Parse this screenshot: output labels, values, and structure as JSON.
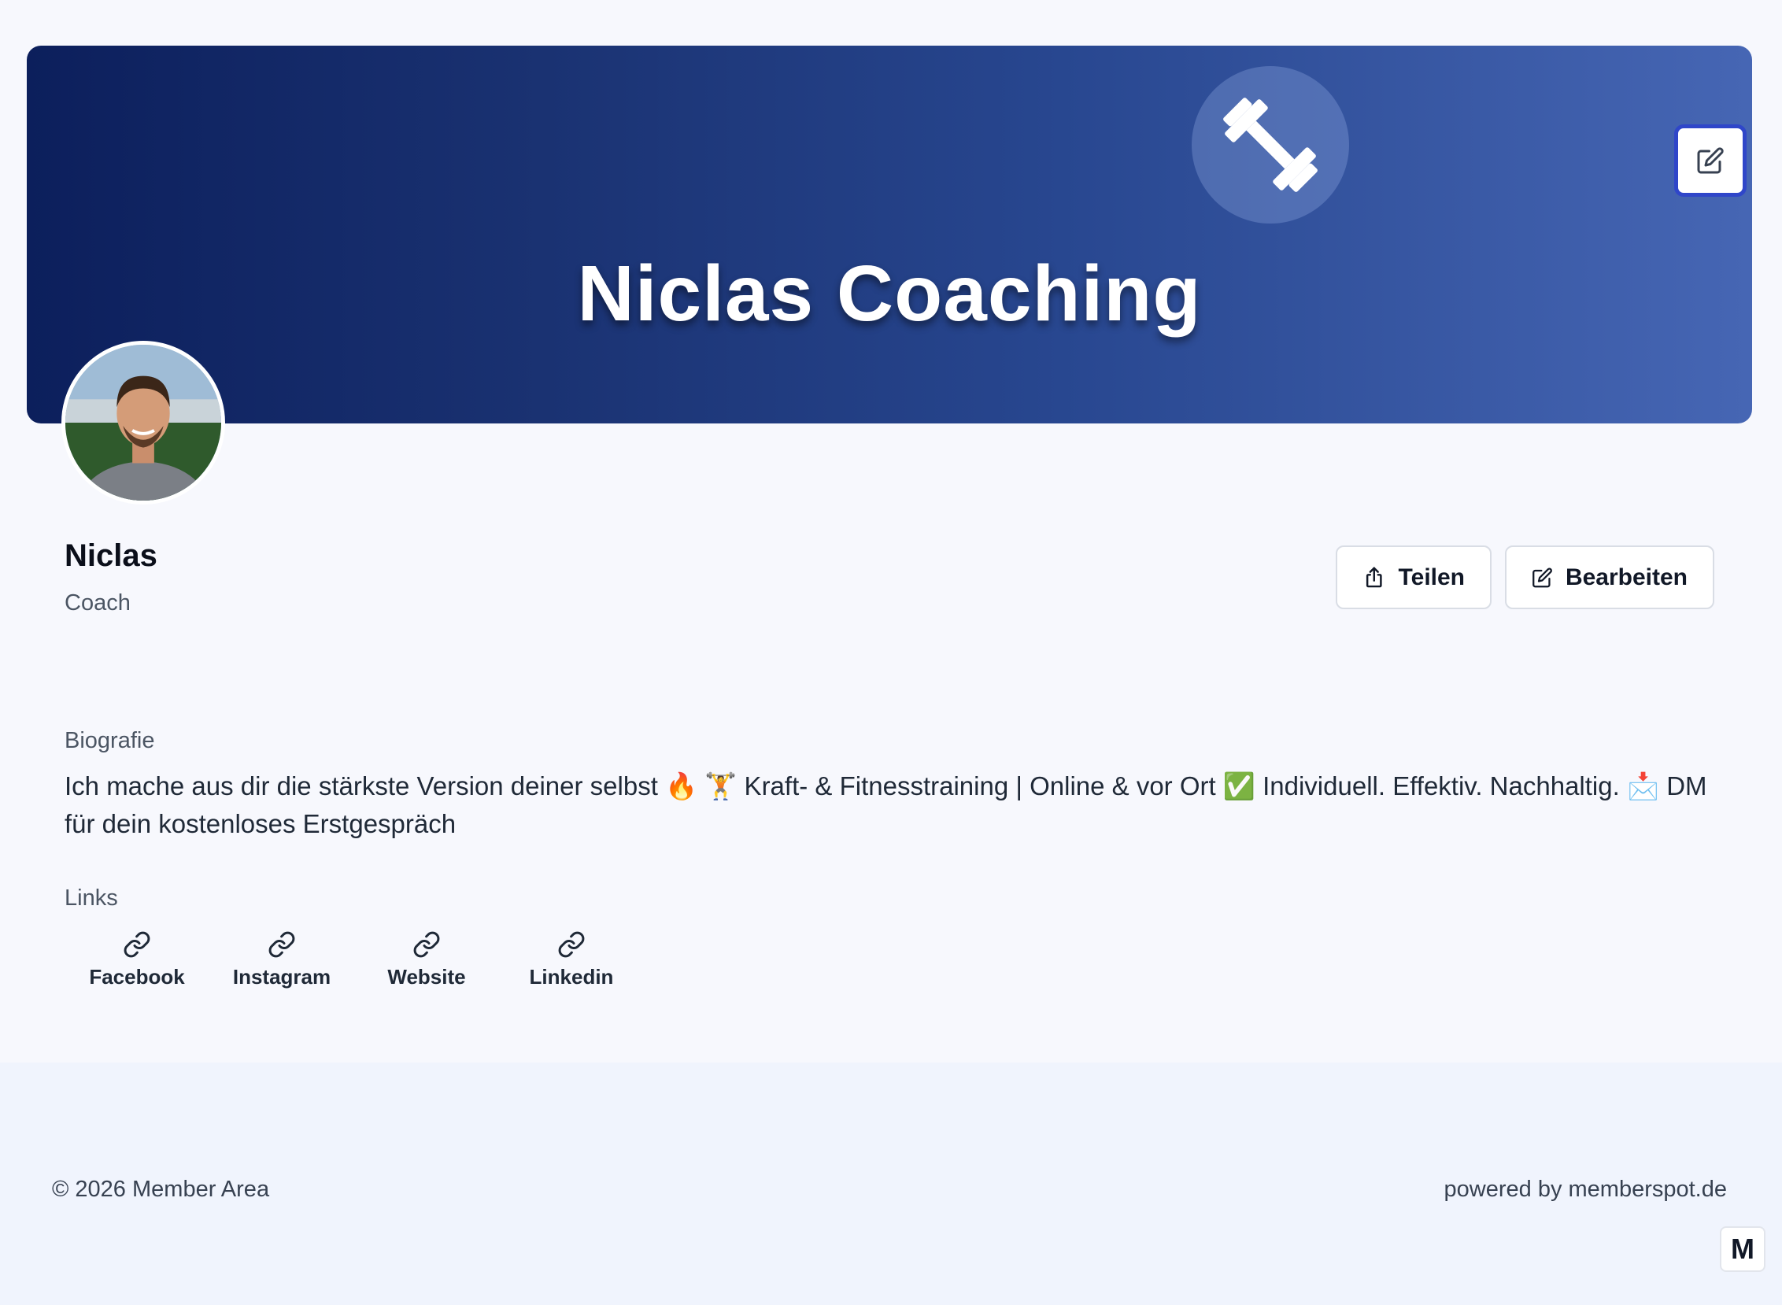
{
  "banner": {
    "title": "Niclas Coaching",
    "logo_icon": "dumbbell-icon",
    "edit_icon": "pencil-edit-icon",
    "accent_color": "#2f46c9"
  },
  "profile": {
    "name": "Niclas",
    "role": "Coach",
    "avatar_icon": "profile-photo"
  },
  "actions": {
    "share_label": "Teilen",
    "edit_label": "Bearbeiten"
  },
  "biography": {
    "label": "Biografie",
    "text": "Ich mache aus dir die stärkste Version deiner selbst 🔥 🏋️ Kraft- & Fitnesstraining | Online & vor Ort ✅ Individuell. Effektiv. Nachhaltig. 📩 DM für dein kostenloses Erstgespräch"
  },
  "links": {
    "label": "Links",
    "items": [
      {
        "label": "Facebook",
        "icon": "link-icon"
      },
      {
        "label": "Instagram",
        "icon": "link-icon"
      },
      {
        "label": "Website",
        "icon": "link-icon"
      },
      {
        "label": "Linkedin",
        "icon": "link-icon"
      }
    ]
  },
  "footer": {
    "copyright": "© 2026 Member Area",
    "powered_by": "powered by memberspot.de",
    "badge_letter": "M"
  }
}
